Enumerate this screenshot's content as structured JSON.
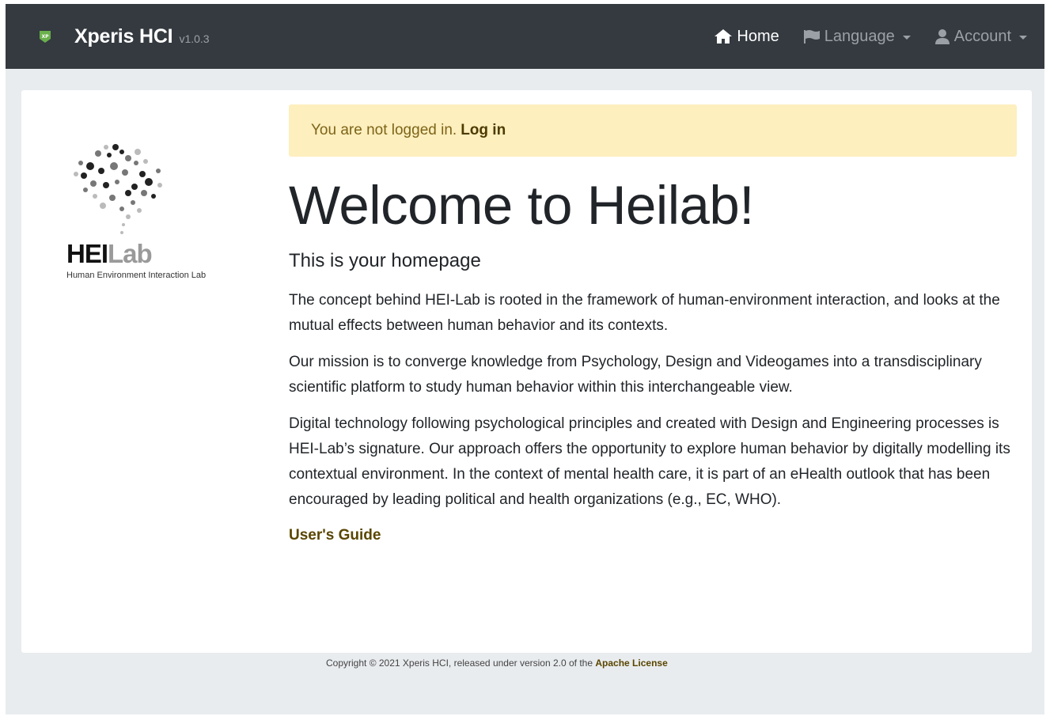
{
  "navbar": {
    "logo_text": "XP",
    "brand_name": "Xperis HCI",
    "brand_version": "v1.0.3",
    "items": [
      {
        "label": "Home",
        "icon": "home-icon",
        "active": true
      },
      {
        "label": "Language",
        "icon": "flag-icon",
        "active": false
      },
      {
        "label": "Account",
        "icon": "user-icon",
        "active": false
      }
    ]
  },
  "sidebar": {
    "logo_title_dark": "HEI",
    "logo_title_light": "Lab",
    "logo_subtitle": "Human Environment Interaction Lab"
  },
  "main": {
    "alert_text": "You are not logged in.",
    "alert_link": "Log in",
    "title": "Welcome to Heilab!",
    "lead": "This is your homepage",
    "paragraphs": [
      "The concept behind HEI-Lab is rooted in the framework of human-environment interaction, and looks at the mutual effects between human behavior and its contexts.",
      "Our mission is to converge knowledge from Psychology, Design and Videogames into a transdisciplinary scientific platform to study human behavior within this interchangeable view.",
      "Digital technology following psychological principles and created with Design and Engineering processes is HEI-Lab’s signature. Our approach offers the opportunity to explore human behavior by digitally modelling its contextual environment. In the context of mental health care, it is part of an eHealth outlook that has been encouraged by leading political and health organizations (e.g., EC, WHO)."
    ],
    "guide_link": "User's Guide"
  },
  "footer": {
    "text": "Copyright © 2021 Xperis HCI, released under version 2.0 of the",
    "link": "Apache License"
  },
  "colors": {
    "navbar_bg": "#343a40",
    "page_bg": "#e9ecef",
    "alert_bg": "#fdefbe",
    "link": "#5a4600",
    "brand_logo": "#6ab04c"
  }
}
